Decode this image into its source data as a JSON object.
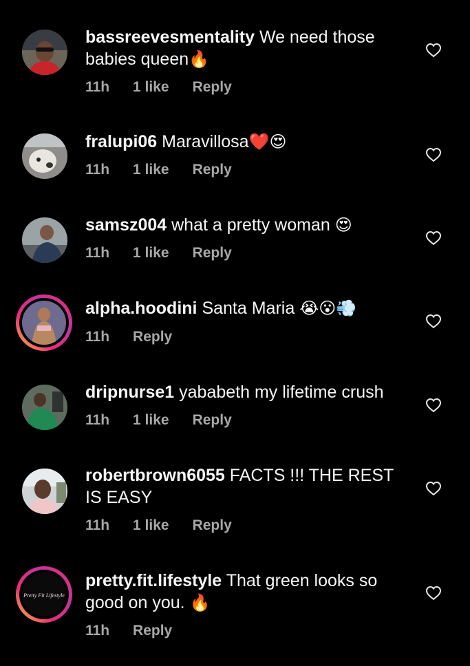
{
  "comments": [
    {
      "username": "bassreevesmentality",
      "text": "We need those babies queen",
      "emoji": "🔥",
      "time": "11h",
      "likes": "1 like",
      "reply": "Reply"
    },
    {
      "username": "fralupi06",
      "text": "Maravillosa",
      "emoji": "❤️😍",
      "time": "11h",
      "likes": "1 like",
      "reply": "Reply"
    },
    {
      "username": "samsz004",
      "text": "what a pretty woman",
      "emoji": "😍",
      "time": "11h",
      "likes": "1 like",
      "reply": "Reply"
    },
    {
      "username": "alpha.hoodini",
      "text": "Santa Maria",
      "emoji": "😭😮💨",
      "time": "11h",
      "reply": "Reply"
    },
    {
      "username": "dripnurse1",
      "text": "yababeth my lifetime crush",
      "time": "11h",
      "likes": "1 like",
      "reply": "Reply"
    },
    {
      "username": "robertbrown6055",
      "text": "FACTS !!! THE REST IS EASY",
      "time": "11h",
      "likes": "1 like",
      "reply": "Reply"
    },
    {
      "username": "pretty.fit.lifestyle",
      "text": "That green looks so good on you.",
      "emoji": "🔥",
      "time": "11h",
      "reply": "Reply",
      "avatar_text": "Pretty Fit Lifestyle"
    }
  ]
}
